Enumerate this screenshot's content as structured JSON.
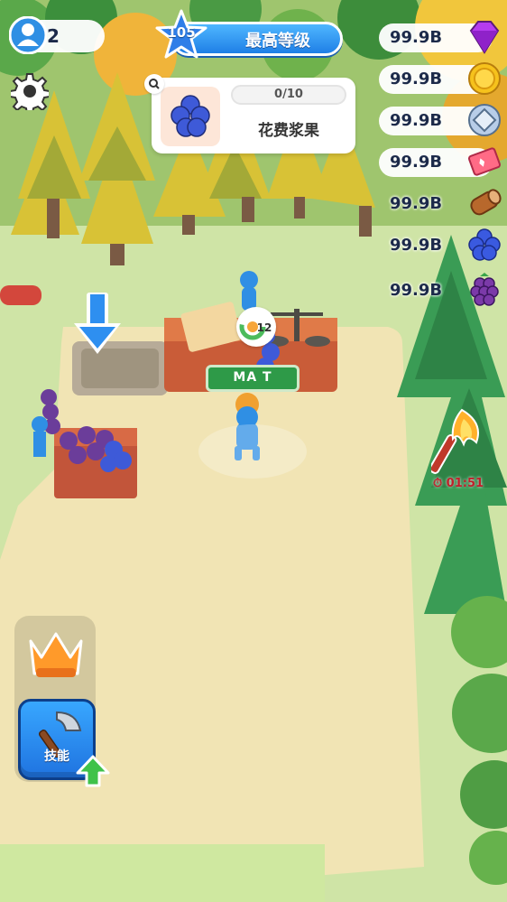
{
  "hud": {
    "player_count": "2",
    "level": {
      "number": "105",
      "title": "最高等级"
    },
    "task": {
      "progress": "0/10",
      "label": "花费浆果"
    }
  },
  "resources": [
    {
      "name": "gem",
      "value": "99.9B",
      "icon": "gem-icon",
      "color": "#b53cf0"
    },
    {
      "name": "coin",
      "value": "99.9B",
      "icon": "coin-icon",
      "color": "#f6c21c"
    },
    {
      "name": "silver-coin",
      "value": "99.9B",
      "icon": "silver-coin-icon",
      "color": "#b8cde8"
    },
    {
      "name": "ticket",
      "value": "99.9B",
      "icon": "ticket-icon",
      "color": "#ff6b86"
    },
    {
      "name": "wood",
      "value": "99.9B",
      "icon": "wood-log-icon",
      "color": "#b8682c"
    },
    {
      "name": "blueberry",
      "value": "99.9B",
      "icon": "blueberry-icon",
      "color": "#3a5ae0"
    },
    {
      "name": "blackberry",
      "value": "99.9B",
      "icon": "blackberry-icon",
      "color": "#7b3aa8"
    }
  ],
  "torch_timer": "01:51",
  "market": {
    "sign": "MA T",
    "badge_count": "12"
  },
  "skill_button": {
    "label": "技能"
  },
  "colors": {
    "accent_blue": "#1f7fe6",
    "ground": "#f1e4b4",
    "grass": "#cfe4a6",
    "timer_red": "#c0202a"
  }
}
